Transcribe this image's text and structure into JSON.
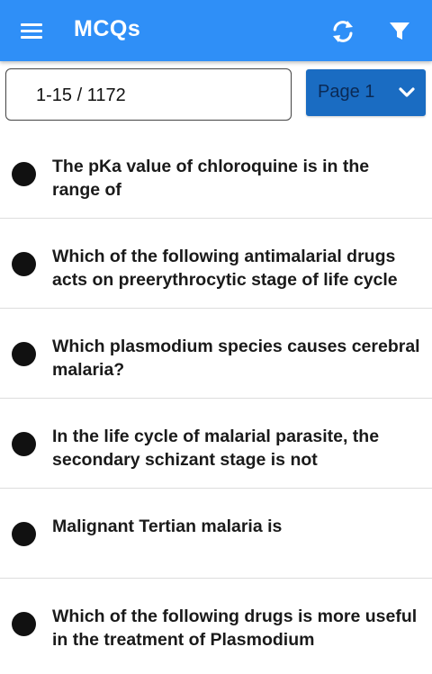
{
  "app": {
    "title": "MCQs"
  },
  "toolbar": {
    "menu_icon": "hamburger-menu-icon",
    "refresh_icon": "refresh-icon",
    "filter_icon": "filter-icon"
  },
  "pagination": {
    "range_text": "1-15 / 1172",
    "page_label": "Page 1"
  },
  "colors": {
    "appbar": "#2f8ff7",
    "page_button": "#1a6cc2",
    "bullet": "#111111"
  },
  "questions": [
    {
      "text": "The pKa value of chloroquine is in the range of"
    },
    {
      "text": "Which of the following antimalarial drugs acts on preerythrocytic stage of life cycle"
    },
    {
      "text": "Which plasmodium species causes cerebral malaria?"
    },
    {
      "text": "In the life cycle of malarial parasite, the secondary schizant stage is not"
    },
    {
      "text": "Malignant Tertian malaria is"
    },
    {
      "text": "Which of the following drugs is more useful in the treatment of Plasmodium"
    }
  ]
}
